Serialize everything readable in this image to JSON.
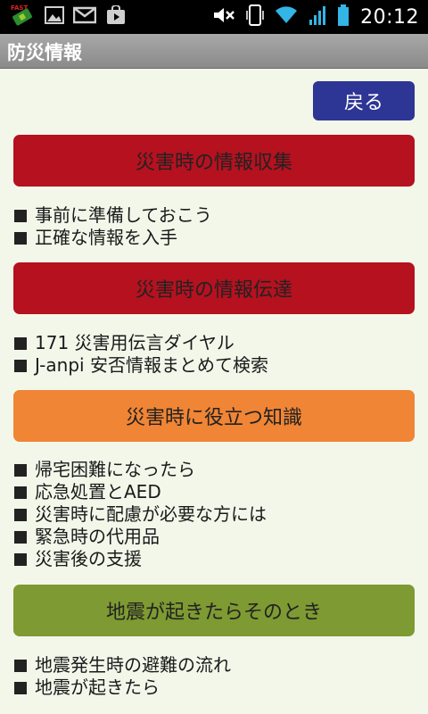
{
  "status_bar": {
    "time": "20:12",
    "left_icons": [
      "satellite-app-icon",
      "image-icon",
      "mail-icon",
      "store-icon"
    ],
    "right_icons": [
      "mute-icon",
      "vibrate-icon",
      "wifi-icon",
      "signal-icon",
      "battery-icon"
    ]
  },
  "app_bar": {
    "title": "防災情報"
  },
  "back_button": {
    "label": "戻る",
    "color": "#2d3595"
  },
  "sections": [
    {
      "title": "災害時の情報収集",
      "color": "#b5111f",
      "items": [
        "事前に準備しておこう",
        "正確な情報を入手"
      ]
    },
    {
      "title": "災害時の情報伝達",
      "color": "#b5111f",
      "items": [
        "171 災害用伝言ダイヤル",
        "J-anpi 安否情報まとめて検索"
      ]
    },
    {
      "title": "災害時に役立つ知識",
      "color": "#f08535",
      "items": [
        "帰宅困難になったら",
        "応急処置とAED",
        "災害時に配慮が必要な方には",
        "緊急時の代用品",
        "災害後の支援"
      ]
    },
    {
      "title": "地震が起きたらそのとき",
      "color": "#7e9a32",
      "items": [
        "地震発生時の避難の流れ",
        "地震が起きたら"
      ]
    }
  ]
}
